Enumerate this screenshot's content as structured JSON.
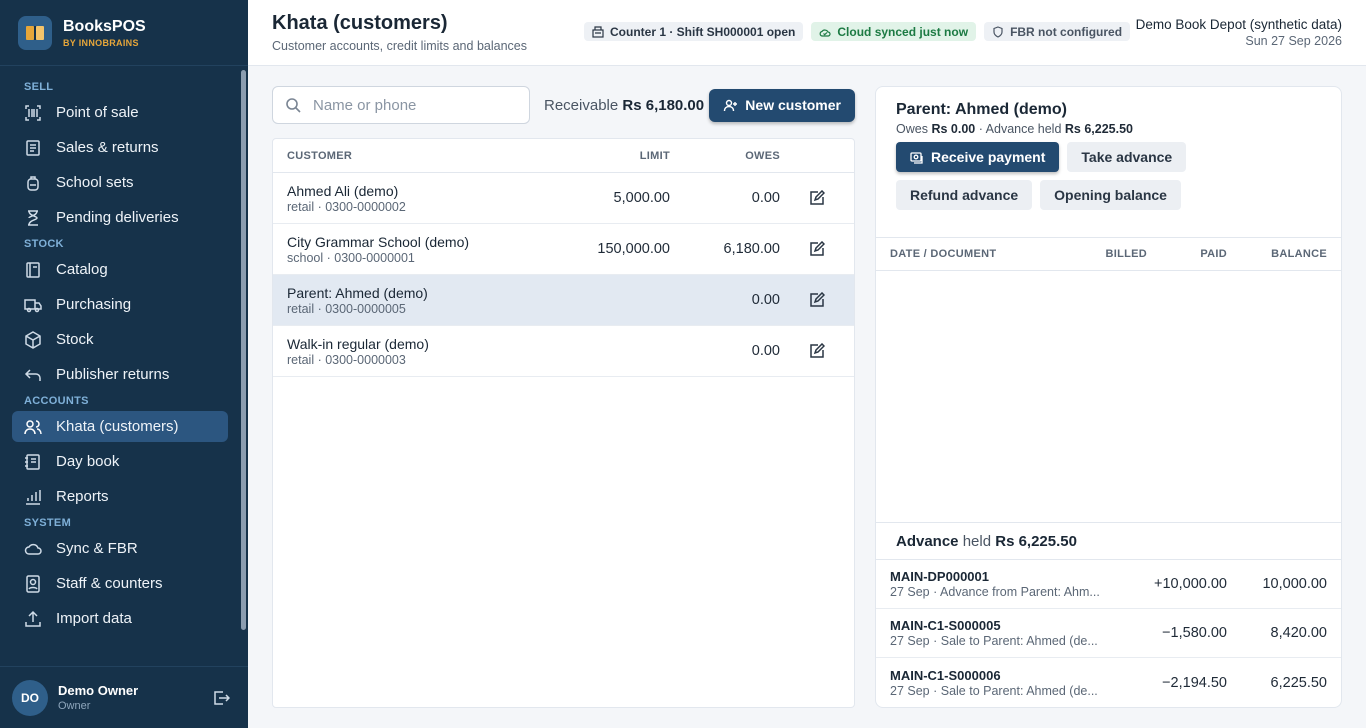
{
  "brand": {
    "name": "BooksPOS",
    "sub": "BY INNOBRAINS"
  },
  "sidebar": {
    "sections": [
      {
        "label": "SELL",
        "items": [
          {
            "label": "Point of sale",
            "icon": "barcode-icon"
          },
          {
            "label": "Sales & returns",
            "icon": "receipt-icon"
          },
          {
            "label": "School sets",
            "icon": "backpack-icon"
          },
          {
            "label": "Pending deliveries",
            "icon": "hourglass-icon"
          }
        ]
      },
      {
        "label": "STOCK",
        "items": [
          {
            "label": "Catalog",
            "icon": "book-icon"
          },
          {
            "label": "Purchasing",
            "icon": "truck-icon"
          },
          {
            "label": "Stock",
            "icon": "box-icon"
          },
          {
            "label": "Publisher returns",
            "icon": "return-arrow-icon"
          }
        ]
      },
      {
        "label": "ACCOUNTS",
        "items": [
          {
            "label": "Khata (customers)",
            "icon": "users-icon",
            "active": true
          },
          {
            "label": "Day book",
            "icon": "notebook-icon"
          },
          {
            "label": "Reports",
            "icon": "bar-chart-icon"
          }
        ]
      },
      {
        "label": "SYSTEM",
        "items": [
          {
            "label": "Sync & FBR",
            "icon": "cloud-icon"
          },
          {
            "label": "Staff & counters",
            "icon": "id-badge-icon"
          },
          {
            "label": "Import data",
            "icon": "upload-icon"
          }
        ]
      }
    ],
    "user": {
      "initials": "DO",
      "name": "Demo Owner",
      "role": "Owner"
    }
  },
  "header": {
    "title": "Khata (customers)",
    "subtitle": "Customer accounts, credit limits and balances",
    "chips": {
      "counter": "Counter 1 · Shift SH000001 open",
      "cloud": "Cloud synced just now",
      "fbr": "FBR not configured"
    },
    "org_name": "Demo Book Depot (synthetic data)",
    "date": "Sun 27 Sep 2026"
  },
  "search": {
    "placeholder": "Name or phone",
    "value": ""
  },
  "receivable": {
    "label": "Receivable",
    "amount": "Rs 6,180.00"
  },
  "new_customer_label": "New customer",
  "customers": {
    "headers": {
      "customer": "CUSTOMER",
      "limit": "LIMIT",
      "owes": "OWES"
    },
    "rows": [
      {
        "name": "Ahmed Ali (demo)",
        "meta": "retail · 0300-0000002",
        "limit": "5,000.00",
        "owes": "0.00"
      },
      {
        "name": "City Grammar School (demo)",
        "meta": "school · 0300-0000001",
        "limit": "150,000.00",
        "owes": "6,180.00"
      },
      {
        "name": "Parent: Ahmed (demo)",
        "meta": "retail · 0300-0000005",
        "limit": "",
        "owes": "0.00",
        "selected": true
      },
      {
        "name": "Walk-in regular (demo)",
        "meta": "retail · 0300-0000003",
        "limit": "",
        "owes": "0.00"
      }
    ]
  },
  "detail": {
    "title": "Parent: Ahmed (demo)",
    "owes_label": "Owes",
    "owes": "Rs 0.00",
    "advance_label": "· Advance held",
    "advance": "Rs 6,225.50",
    "actions": {
      "receive": "Receive payment",
      "take_advance": "Take advance",
      "refund_advance": "Refund advance",
      "opening_balance": "Opening balance"
    },
    "ledger_headers": {
      "doc": "DATE / DOCUMENT",
      "billed": "BILLED",
      "paid": "PAID",
      "balance": "BALANCE"
    },
    "advance_section": {
      "label_strong": "Advance",
      "label": "held",
      "amount": "Rs 6,225.50"
    },
    "advance_rows": [
      {
        "id": "MAIN-DP000001",
        "desc": "27 Sep · Advance from Parent: Ahm...",
        "amount": "+10,000.00",
        "balance": "10,000.00"
      },
      {
        "id": "MAIN-C1-S000005",
        "desc": "27 Sep · Sale to Parent: Ahmed (de...",
        "amount": "−1,580.00",
        "balance": "8,420.00"
      },
      {
        "id": "MAIN-C1-S000006",
        "desc": "27 Sep · Sale to Parent: Ahmed (de...",
        "amount": "−2,194.50",
        "balance": "6,225.50"
      }
    ]
  },
  "colors": {
    "sidebar": "#16324a",
    "accent": "#234a70",
    "brand_sub": "#e6a63a",
    "synced": "#1c7a43"
  }
}
